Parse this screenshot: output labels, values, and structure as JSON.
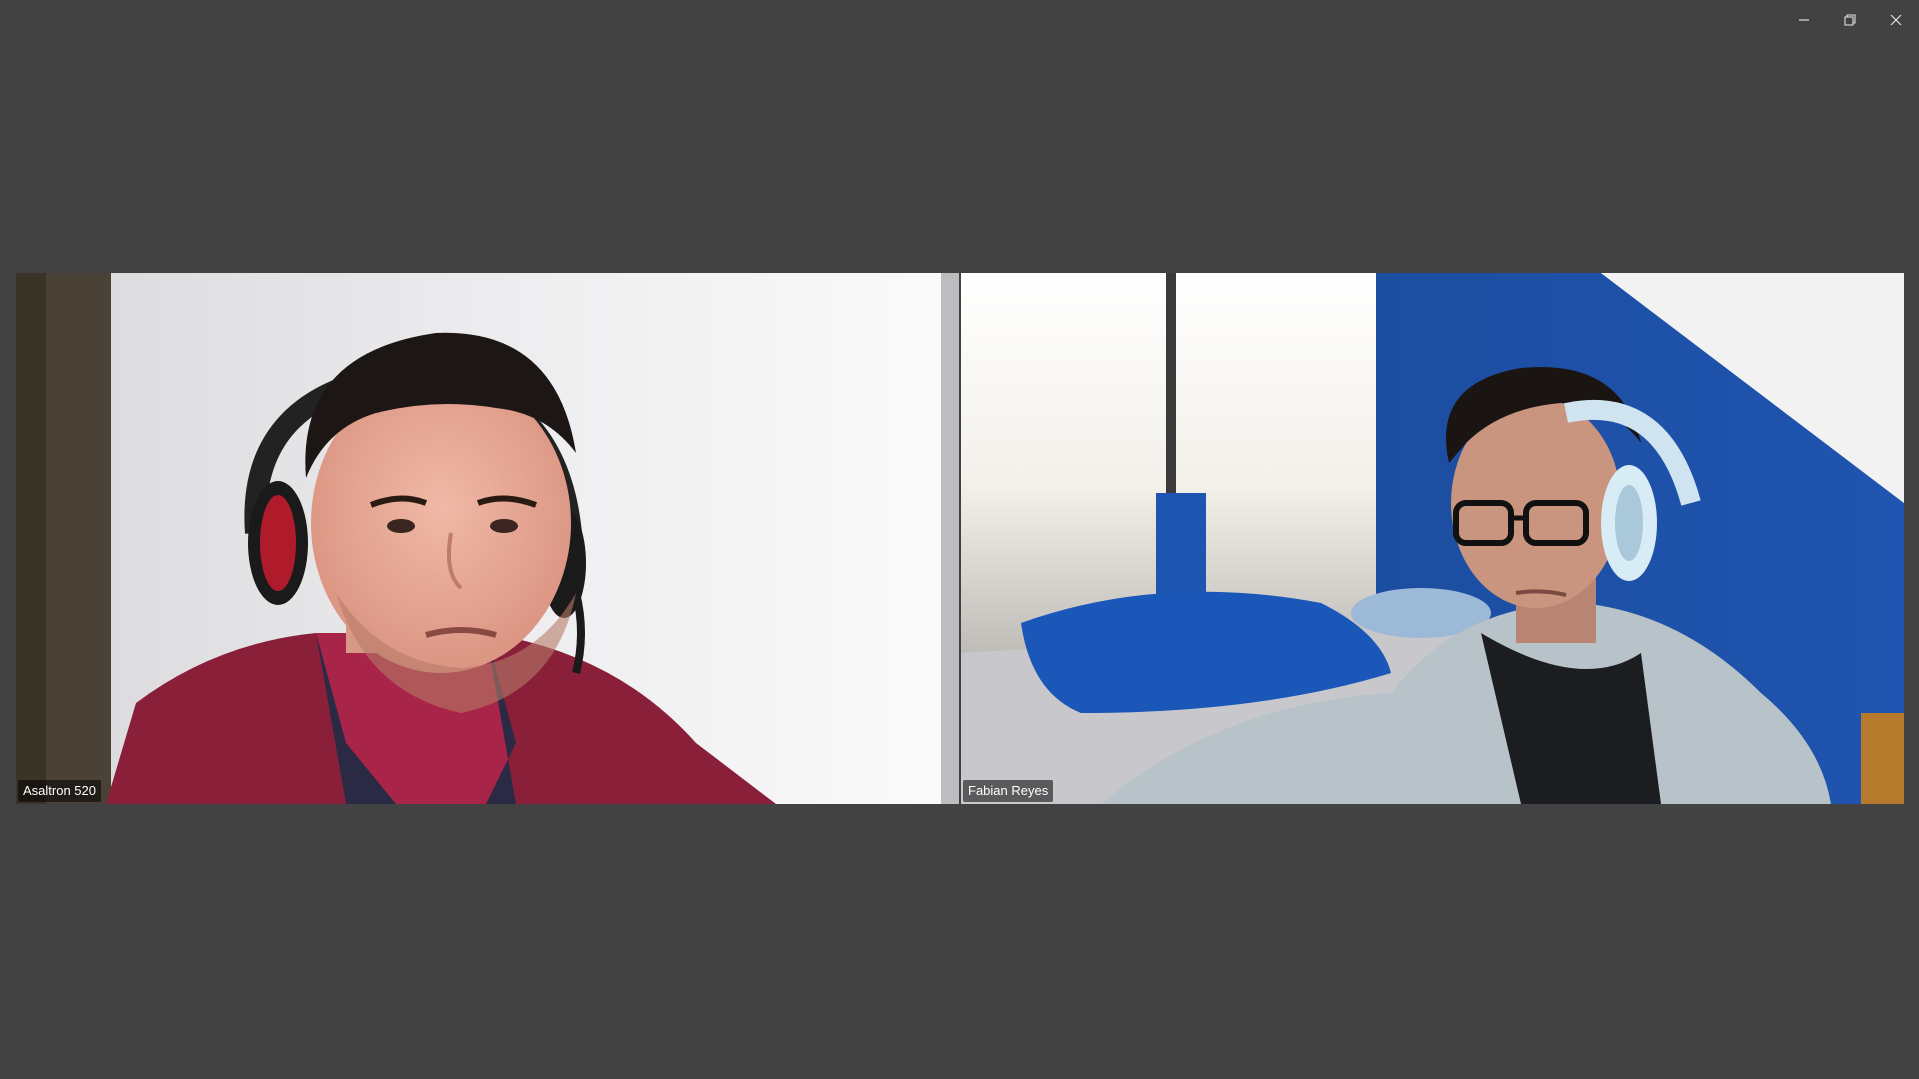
{
  "window": {
    "controls": [
      {
        "icon": "minimize-icon"
      },
      {
        "icon": "restore-icon"
      },
      {
        "icon": "close-icon"
      }
    ]
  },
  "participants": [
    {
      "name": "Asaltron 520"
    },
    {
      "name": "Fabian Reyes"
    }
  ],
  "colors": {
    "background": "#424242",
    "name_tag_bg": "rgba(0,0,0,0.55)",
    "name_tag_text": "#ffffff"
  }
}
